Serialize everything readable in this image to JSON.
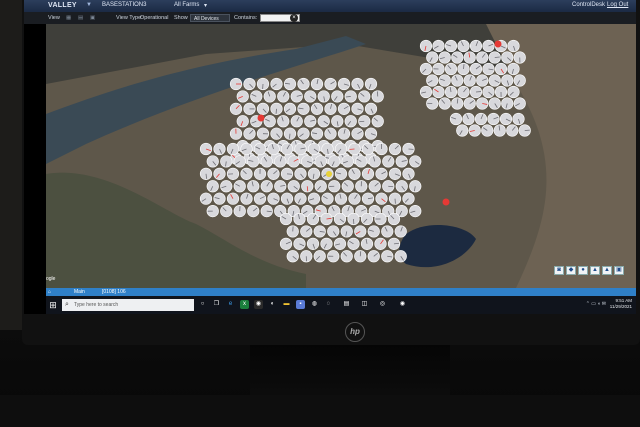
{
  "app": {
    "brand": "VALLEY",
    "product": "BASESTATION3",
    "farm_filter": "All Farms",
    "top_link": "ControlDesk",
    "logout": "Log Out"
  },
  "toolbar": {
    "view_label": "View",
    "view_type_label": "View Type:",
    "view_type_value": "Operational",
    "show_label": "Show",
    "show_value": "All Devices",
    "contains_label": "Contains:",
    "contains_value": "",
    "clear_glyph": "×"
  },
  "statusbar": {
    "tab_main": "Main",
    "count": "[0108] 106"
  },
  "taskbar": {
    "search_placeholder": "Type here to search",
    "time": "9:51 AM",
    "date": "11/29/2021"
  },
  "map": {
    "zoom_label": "ogle",
    "pivot_color": "#d8d8dc",
    "alert_color": "#e53935",
    "terrain_color": "#6a5f50"
  },
  "monitor": {
    "brand": "hp"
  }
}
